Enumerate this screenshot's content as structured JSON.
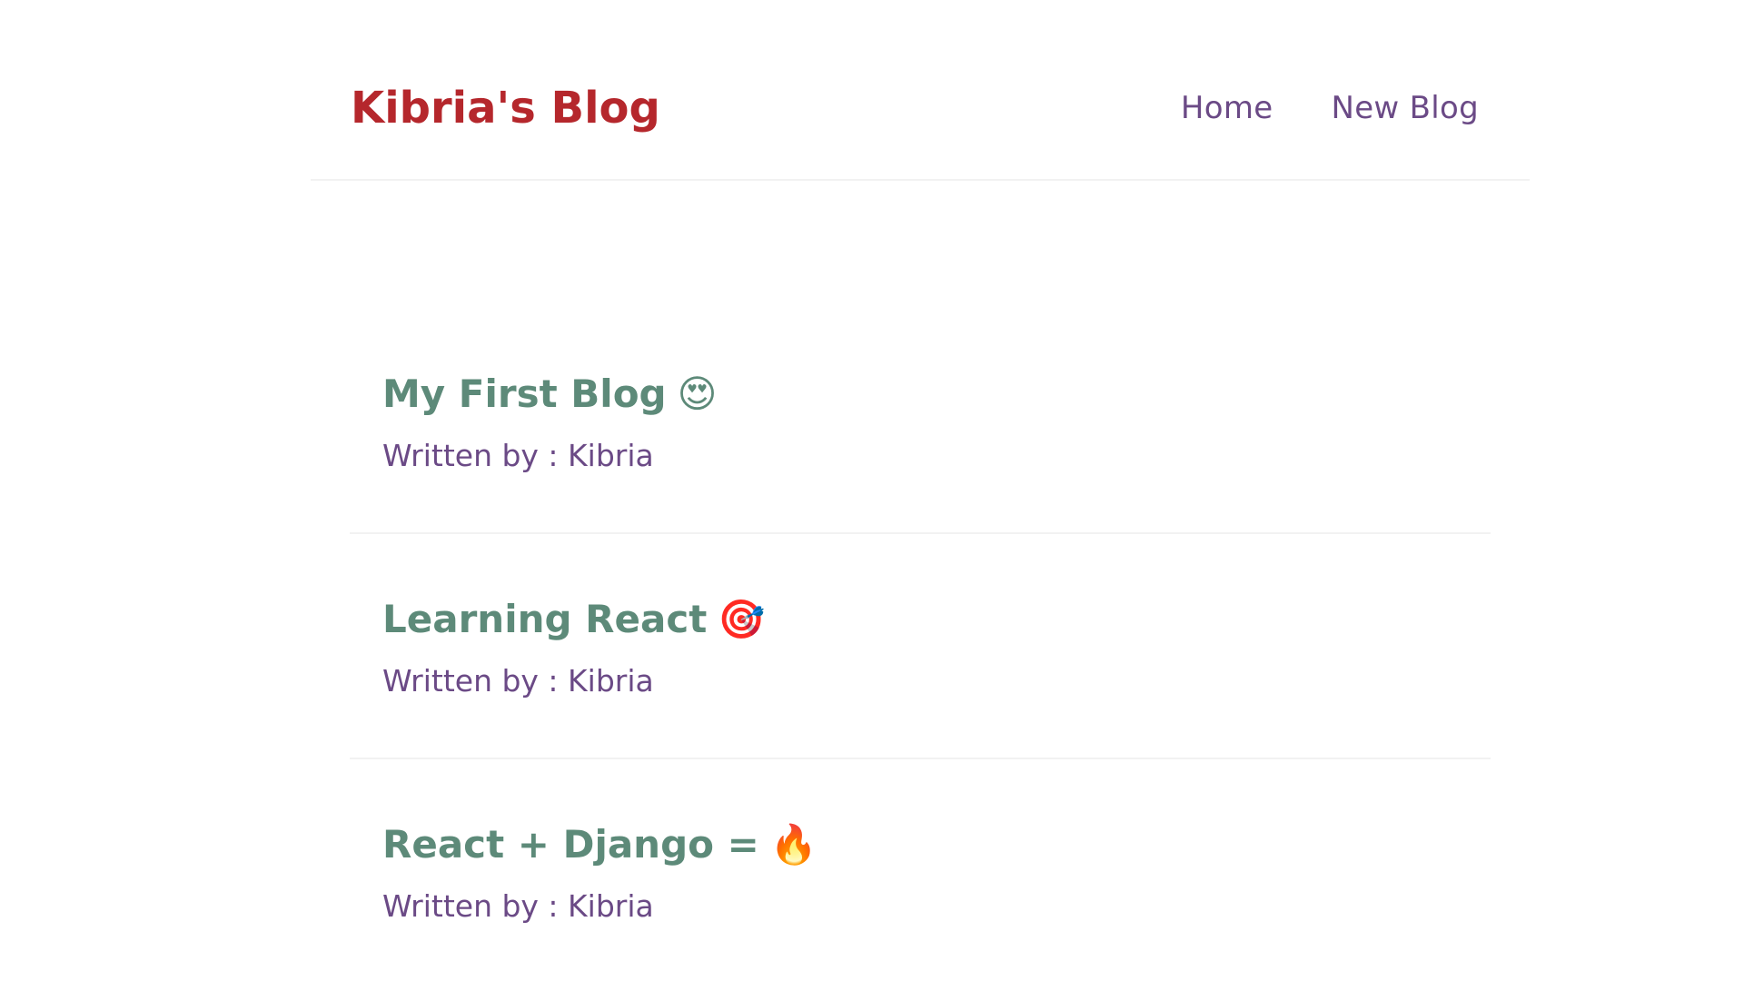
{
  "header": {
    "brand": "Kibria's Blog",
    "nav": [
      "Home",
      "New Blog"
    ]
  },
  "blogs": [
    {
      "title": "My First Blog",
      "emoji": "😍",
      "emoji_name": "heart-eyes-emoji-icon",
      "author_label": "Written by : Kibria"
    },
    {
      "title": "Learning React",
      "emoji": "🎯",
      "emoji_name": "target-emoji-icon",
      "author_label": "Written by : Kibria"
    },
    {
      "title": "React + Django =",
      "emoji": "🔥",
      "emoji_name": "fire-emoji-icon",
      "author_label": "Written by : Kibria"
    }
  ],
  "colors": {
    "brand": "#b5272c",
    "nav_link": "#6b4a86",
    "blog_title": "#5d8a79",
    "divider": "#f2f2f2"
  }
}
